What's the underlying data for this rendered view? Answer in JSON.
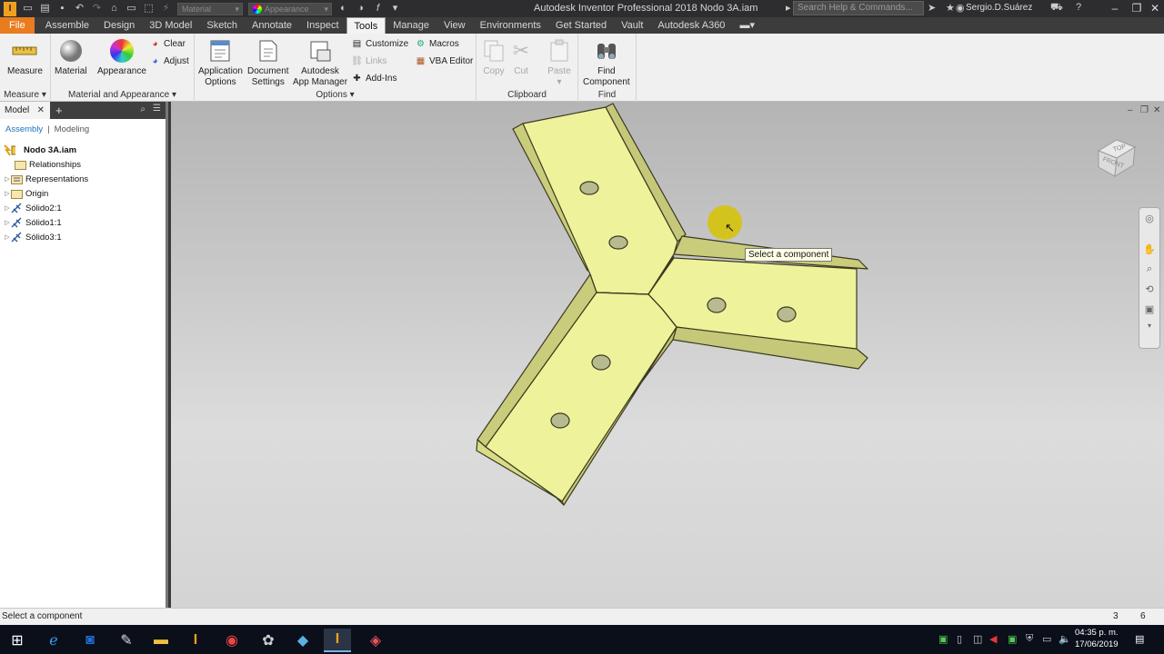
{
  "app": {
    "window_title": "Autodesk Inventor Professional 2018    Nodo 3A.iam",
    "search_placeholder": "Search Help & Commands...",
    "user": "Sergio.D.Suárez",
    "material_dropdown": "Material",
    "appearance_dropdown": "Appearance"
  },
  "ribbon_tabs": [
    "File",
    "Assemble",
    "Design",
    "3D Model",
    "Sketch",
    "Annotate",
    "Inspect",
    "Tools",
    "Manage",
    "View",
    "Environments",
    "Get Started",
    "Vault",
    "Autodesk A360"
  ],
  "active_tab": "Tools",
  "ribbon": {
    "measure": "Measure",
    "material": "Material",
    "appearance": "Appearance",
    "clear": "Clear",
    "adjust": "Adjust",
    "application_options": [
      "Application",
      "Options"
    ],
    "document_settings": [
      "Document",
      "Settings"
    ],
    "app_manager": [
      "Autodesk",
      "App Manager"
    ],
    "customize": "Customize",
    "links": "Links",
    "add_ins": "Add-Ins",
    "macros": "Macros",
    "vba_editor": "VBA Editor",
    "copy": "Copy",
    "cut": "Cut",
    "paste": "Paste",
    "find_component": [
      "Find",
      "Component"
    ],
    "groups": {
      "measure": "Measure",
      "material_appearance": "Material and Appearance",
      "options": "Options",
      "clipboard": "Clipboard",
      "find": "Find"
    }
  },
  "browser": {
    "tab": "Model",
    "switch_assembly": "Assembly",
    "switch_modeling": "Modeling",
    "tree": [
      {
        "label": "Nodo 3A.iam",
        "icon": "assembly-icon"
      },
      {
        "label": "Relationships",
        "icon": "folder-icon"
      },
      {
        "label": "Representations",
        "icon": "representations-icon"
      },
      {
        "label": "Origin",
        "icon": "folder-icon"
      },
      {
        "label": "Sólido2:1",
        "icon": "part-icon"
      },
      {
        "label": "Sólido1:1",
        "icon": "part-icon"
      },
      {
        "label": "Sólido3:1",
        "icon": "part-icon"
      }
    ]
  },
  "viewport": {
    "tooltip": "Select a component",
    "viewcube_top": "TOP",
    "viewcube_front": "FRONT",
    "model_color": "#eef29a"
  },
  "status": {
    "message": "Select a component",
    "count1": "3",
    "count2": "6"
  },
  "taskbar": {
    "time": "04:35 p. m.",
    "date": "17/06/2019"
  }
}
